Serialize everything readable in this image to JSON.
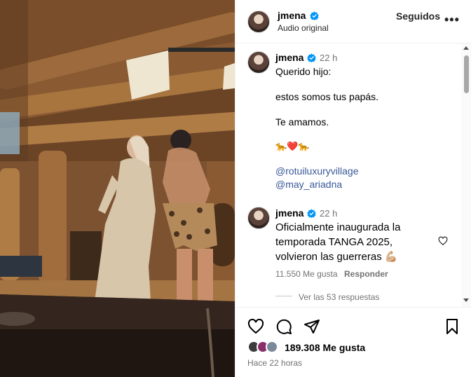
{
  "post": {
    "author": "jmena",
    "audio": "Audio original",
    "follow_label": "Seguidos",
    "more_label": "•••"
  },
  "comments": [
    {
      "author": "jmena",
      "time": "22 h",
      "lines": [
        "Querido hijo:",
        "estos somos tus papás.",
        "Te amamos."
      ],
      "emojis": "🐆❤️🐆",
      "mentions": [
        "@rotuiluxuryvillage",
        "@may_ariadna"
      ]
    },
    {
      "author": "jmena",
      "time": "22 h",
      "text": "Oficialmente inaugurada la temporada TANGA 2025, volvieron las guerreras 💪🏼",
      "likes": "11.550 Me gusta",
      "reply_label": "Responder",
      "view_replies": "Ver las 53 respuestas"
    }
  ],
  "footer": {
    "likes": "189.308 Me gusta",
    "time_ago": "Hace 22 horas"
  },
  "icons": {
    "like": "heart-icon",
    "comment": "comment-icon",
    "share": "send-icon",
    "save": "bookmark-icon"
  },
  "colors": {
    "verified": "#0095f6",
    "mention": "#385898",
    "muted": "#737373"
  }
}
